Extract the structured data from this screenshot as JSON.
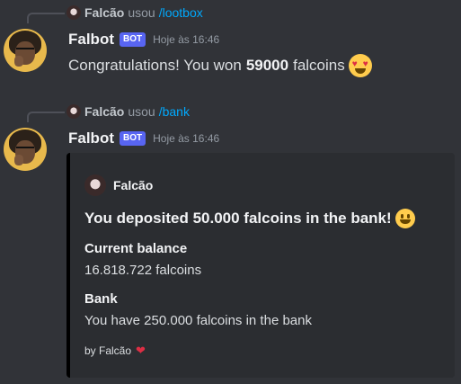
{
  "messages": [
    {
      "reply": {
        "user": "Falcão",
        "verb": "usou",
        "command": "/lootbox"
      },
      "author": "Falbot",
      "badge": "BOT",
      "timestamp": "Hoje às 16:46",
      "text_before": "Congratulations! You won",
      "amount": "59000",
      "text_after": "falcoins",
      "emoji": "heart-eyes-emoji"
    },
    {
      "reply": {
        "user": "Falcão",
        "verb": "usou",
        "command": "/bank"
      },
      "author": "Falbot",
      "badge": "BOT",
      "timestamp": "Hoje às 16:46",
      "embed": {
        "accent_color": "#000000",
        "author_name": "Falcão",
        "title": "You deposited 50.000 falcoins in the bank!",
        "title_emoji": "smiley-emoji",
        "fields": [
          {
            "name": "Current balance",
            "value": "16.818.722 falcoins"
          },
          {
            "name": "Bank",
            "value": "You have 250.000 falcoins in the bank"
          }
        ],
        "footer": "by Falcão",
        "footer_icon": "heart-icon"
      }
    }
  ],
  "colors": {
    "background": "#313338",
    "bot_badge": "#5865f2",
    "link": "#00a8fc",
    "embed_bg": "#2b2d31"
  }
}
